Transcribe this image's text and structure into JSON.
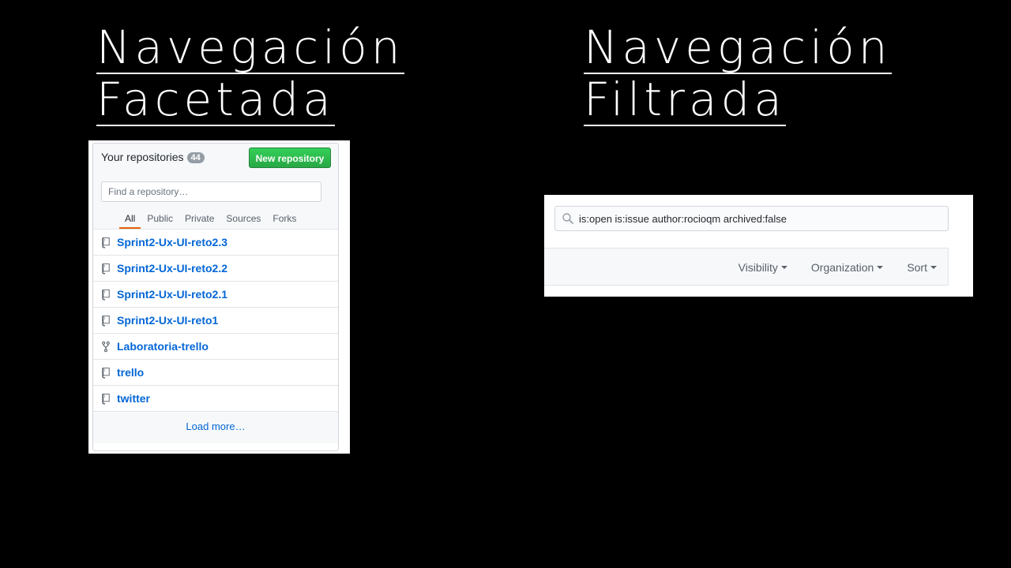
{
  "titles": {
    "left": {
      "line1": "Navegación",
      "line2": "Facetada"
    },
    "right": {
      "line1": "Navegación",
      "line2": "Filtrada"
    }
  },
  "repositories": {
    "heading": "Your repositories",
    "count": "44",
    "new_button": "New repository",
    "find_placeholder": "Find a repository…",
    "tabs": [
      {
        "label": "All",
        "active": true
      },
      {
        "label": "Public",
        "active": false
      },
      {
        "label": "Private",
        "active": false
      },
      {
        "label": "Sources",
        "active": false
      },
      {
        "label": "Forks",
        "active": false
      }
    ],
    "items": [
      {
        "name": "Sprint2-Ux-UI-reto2.3",
        "icon": "repo-icon"
      },
      {
        "name": "Sprint2-Ux-UI-reto2.2",
        "icon": "repo-icon"
      },
      {
        "name": "Sprint2-Ux-UI-reto2.1",
        "icon": "repo-icon"
      },
      {
        "name": "Sprint2-Ux-UI-reto1",
        "icon": "repo-icon"
      },
      {
        "name": "Laboratoria-trello",
        "icon": "fork-icon"
      },
      {
        "name": "trello",
        "icon": "repo-icon"
      },
      {
        "name": "twitter",
        "icon": "repo-icon"
      }
    ],
    "load_more": "Load more…"
  },
  "filter": {
    "search_value": "is:open is:issue author:rocioqm archived:false",
    "dropdowns": [
      "Visibility",
      "Organization",
      "Sort"
    ]
  },
  "colors": {
    "background": "#000000",
    "link": "#0366d6",
    "button_green": "#28a745",
    "tab_underline": "#e36209"
  }
}
